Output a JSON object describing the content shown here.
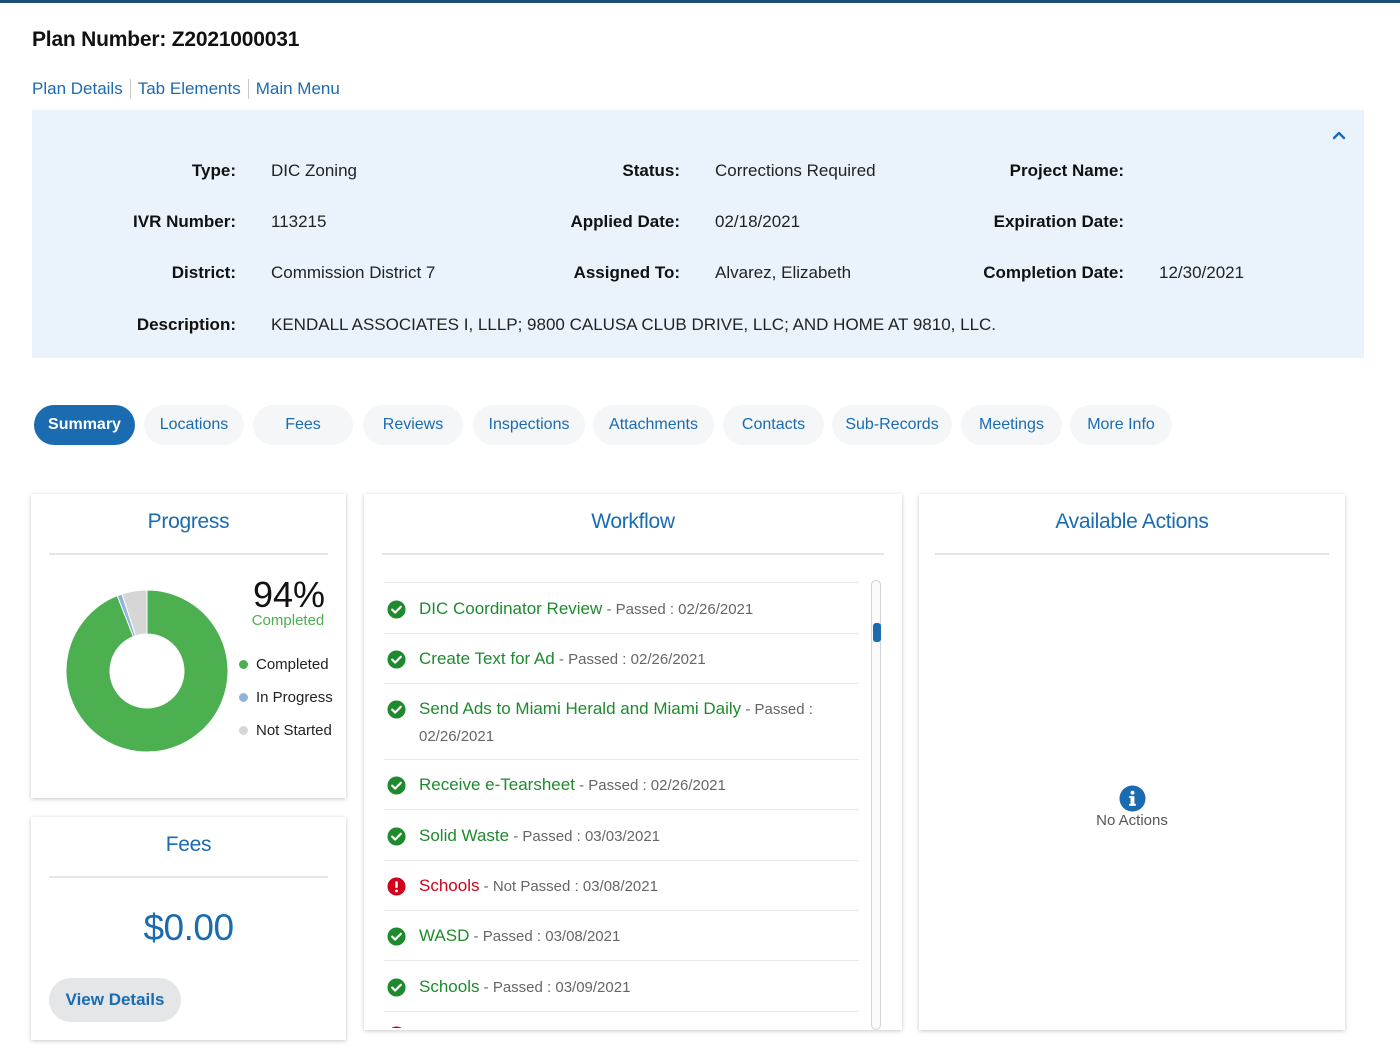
{
  "header": {
    "plan_number": "Plan Number: Z2021000031"
  },
  "breadcrumb": {
    "items": [
      "Plan Details",
      "Tab Elements",
      "Main Menu"
    ]
  },
  "details": {
    "type_label": "Type:",
    "type_value": "DIC Zoning",
    "status_label": "Status:",
    "status_value": "Corrections Required",
    "project_name_label": "Project Name:",
    "project_name_value": "",
    "ivr_label": "IVR Number:",
    "ivr_value": "113215",
    "applied_label": "Applied Date:",
    "applied_value": "02/18/2021",
    "expiration_label": "Expiration Date:",
    "expiration_value": "",
    "district_label": "District:",
    "district_value": "Commission District 7",
    "assigned_label": "Assigned To:",
    "assigned_value": "Alvarez, Elizabeth",
    "completion_label": "Completion Date:",
    "completion_value": "12/30/2021",
    "description_label": "Description:",
    "description_value": "KENDALL ASSOCIATES I, LLLP; 9800 CALUSA CLUB DRIVE, LLC; AND HOME AT 9810, LLC.",
    "collapse_icon": "chevron-up-icon"
  },
  "tabs": [
    {
      "label": "Summary",
      "active": true
    },
    {
      "label": "Locations",
      "active": false
    },
    {
      "label": "Fees",
      "active": false
    },
    {
      "label": "Reviews",
      "active": false
    },
    {
      "label": "Inspections",
      "active": false
    },
    {
      "label": "Attachments",
      "active": false
    },
    {
      "label": "Contacts",
      "active": false
    },
    {
      "label": "Sub-Records",
      "active": false
    },
    {
      "label": "Meetings",
      "active": false
    },
    {
      "label": "More Info",
      "active": false
    }
  ],
  "progress": {
    "title": "Progress",
    "percent_text": "94%",
    "percent_sub": "Completed",
    "fractions": {
      "completed": 0.94,
      "in_progress": 0.01,
      "not_started": 0.05
    },
    "legend": [
      {
        "label": "Completed",
        "color": "#4caf50"
      },
      {
        "label": "In Progress",
        "color": "#90b4d8"
      },
      {
        "label": "Not Started",
        "color": "#d6d6d6"
      }
    ]
  },
  "fees": {
    "title": "Fees",
    "amount": "$0.00",
    "view_details": "View Details"
  },
  "workflow": {
    "title": "Workflow",
    "items": [
      {
        "name": "DIC Coordinator Review",
        "meta": " - Passed : 02/26/2021",
        "status": "passed"
      },
      {
        "name": "Create Text for Ad",
        "meta": " - Passed : 02/26/2021",
        "status": "passed"
      },
      {
        "name": "Send Ads to Miami Herald and Miami Daily",
        "meta": " - Passed : 02/26/2021",
        "status": "passed"
      },
      {
        "name": "Receive e-Tearsheet",
        "meta": " - Passed : 02/26/2021",
        "status": "passed"
      },
      {
        "name": "Solid Waste",
        "meta": " - Passed : 03/03/2021",
        "status": "passed"
      },
      {
        "name": "Schools",
        "meta": " - Not Passed : 03/08/2021",
        "status": "failed"
      },
      {
        "name": "WASD",
        "meta": " - Passed : 03/08/2021",
        "status": "passed"
      },
      {
        "name": "Schools",
        "meta": " - Passed : 03/09/2021",
        "status": "passed"
      }
    ]
  },
  "actions": {
    "title": "Available Actions",
    "empty_text": "No Actions",
    "empty_icon": "info-icon"
  },
  "colors": {
    "accent": "#1a6bb0",
    "success": "#4caf50",
    "fail": "#d0021b",
    "panel_bg": "#eaf3fc"
  }
}
